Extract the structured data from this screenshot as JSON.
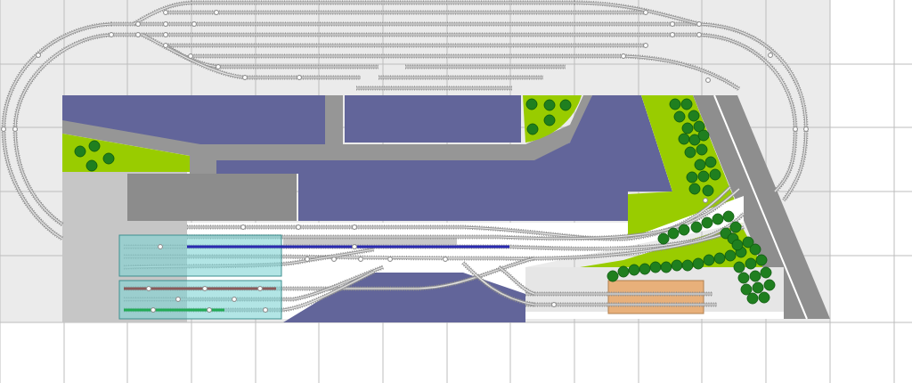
{
  "plan": {
    "kind": "track-plan"
  }
}
